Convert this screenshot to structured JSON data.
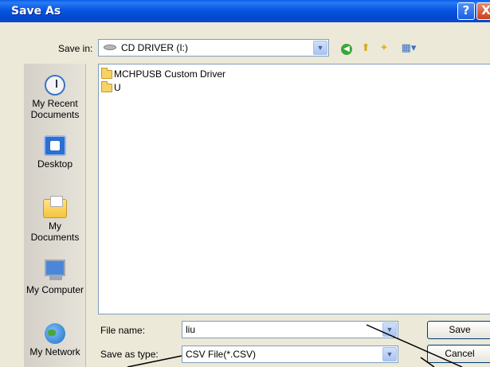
{
  "window": {
    "title": "Save As",
    "help_glyph": "?",
    "close_glyph": "X"
  },
  "toolbar": {
    "save_in_label": "Save in:",
    "save_in_value": "CD DRIVER (I:)",
    "combo_arrow": "▼",
    "back_glyph": "◀",
    "up_glyph": "⬆",
    "new_folder_glyph": "✦",
    "views_glyph": "▦▾"
  },
  "places": [
    {
      "label": "My Recent Documents",
      "icon": "recent-documents-icon"
    },
    {
      "label": "Desktop",
      "icon": "desktop-icon"
    },
    {
      "label": "My Documents",
      "icon": "my-documents-icon"
    },
    {
      "label": "My Computer",
      "icon": "my-computer-icon"
    },
    {
      "label": "My Network",
      "icon": "my-network-icon"
    }
  ],
  "files": [
    {
      "name": "MCHPUSB Custom Driver",
      "icon": "folder-icon"
    },
    {
      "name": "U",
      "icon": "folder-icon"
    }
  ],
  "form": {
    "file_name_label": "File name:",
    "file_name_value": "liu",
    "save_type_label": "Save as type:",
    "save_type_value": "CSV File(*.CSV)",
    "save_label": "Save",
    "cancel_label": "Cancel"
  },
  "colors": {
    "title_bar": "#0756e0",
    "dialog_bg": "#ece9d8",
    "border": "#7f9db9"
  }
}
